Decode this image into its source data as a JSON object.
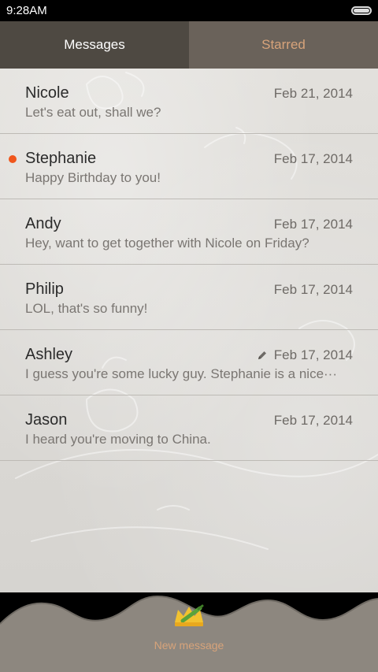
{
  "status": {
    "time": "9:28AM"
  },
  "tabs": [
    {
      "label": "Messages",
      "active": true
    },
    {
      "label": "Starred",
      "active": false
    }
  ],
  "messages": [
    {
      "name": "Nicole",
      "date": "Feb 21, 2014",
      "preview": "Let's eat out, shall we?",
      "unread": false,
      "draft": false
    },
    {
      "name": "Stephanie",
      "date": "Feb 17, 2014",
      "preview": "Happy Birthday to you!",
      "unread": true,
      "draft": false
    },
    {
      "name": "Andy",
      "date": "Feb 17, 2014",
      "preview": "Hey, want to get together with Nicole on Friday?",
      "unread": false,
      "draft": false
    },
    {
      "name": "Philip",
      "date": "Feb 17, 2014",
      "preview": "LOL, that's so funny!",
      "unread": false,
      "draft": false
    },
    {
      "name": "Ashley",
      "date": "Feb 17, 2014",
      "preview": "I guess you're some lucky guy. Stephanie is a nice···",
      "unread": false,
      "draft": true
    },
    {
      "name": "Jason",
      "date": "Feb 17, 2014",
      "preview": "I heard you're moving to China.",
      "unread": false,
      "draft": false
    }
  ],
  "bottom": {
    "new_message_label": "New message"
  },
  "colors": {
    "accent": "#d7a37a",
    "unread": "#f0561c",
    "tab_active": "#4e4942",
    "tab_inactive": "#6a625a"
  },
  "icons": {
    "draft": "pencil-icon",
    "new_message": "crown-pen-icon",
    "battery": "battery-icon"
  }
}
